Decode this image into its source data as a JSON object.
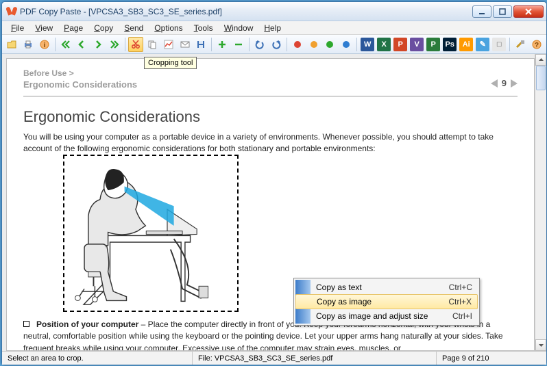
{
  "title": "PDF Copy Paste - [VPCSA3_SB3_SC3_SE_series.pdf]",
  "menus": [
    "File",
    "View",
    "Page",
    "Copy",
    "Send",
    "Options",
    "Tools",
    "Window",
    "Help"
  ],
  "tooltip": "Cropping tool",
  "doc": {
    "breadcrumb": "Before Use >",
    "section": "Ergonomic Considerations",
    "page_num": "9",
    "heading": "Ergonomic Considerations",
    "intro": "You will be using your computer as a portable device in a variety of environments. Whenever possible, you should attempt to take account of the following ergonomic considerations for both stationary and portable environments:",
    "bullet_title": "Position of your computer",
    "bullet_body": " – Place the computer directly in front of you. Keep your forearms horizontal, with your wrists in a neutral, comfortable position while using the keyboard or the pointing device. Let your upper arms hang naturally at your sides. Take frequent breaks while using your computer. Excessive use of the computer may strain eyes, muscles, or"
  },
  "context_menu": [
    {
      "label": "Copy as text",
      "shortcut": "Ctrl+C"
    },
    {
      "label": "Copy as image",
      "shortcut": "Ctrl+X",
      "hl": true
    },
    {
      "label": "Copy as image and adjust size",
      "shortcut": "Ctrl+I"
    }
  ],
  "apps": [
    {
      "bg": "#2b579a",
      "t": "W"
    },
    {
      "bg": "#217346",
      "t": "X"
    },
    {
      "bg": "#d24726",
      "t": "P"
    },
    {
      "bg": "#6a4ea0",
      "t": "V"
    },
    {
      "bg": "#2b7c3b",
      "t": "P"
    },
    {
      "bg": "#001e36",
      "t": "Ps"
    },
    {
      "bg": "#ff9a00",
      "t": "Ai"
    },
    {
      "bg": "#4aa3df",
      "t": "✎"
    },
    {
      "bg": "#e7e7e7",
      "t": "□",
      "c": "#555"
    }
  ],
  "status": {
    "left": "Select an area to crop.",
    "mid": "File: VPCSA3_SB3_SC3_SE_series.pdf",
    "right": "Page 9 of 210"
  }
}
